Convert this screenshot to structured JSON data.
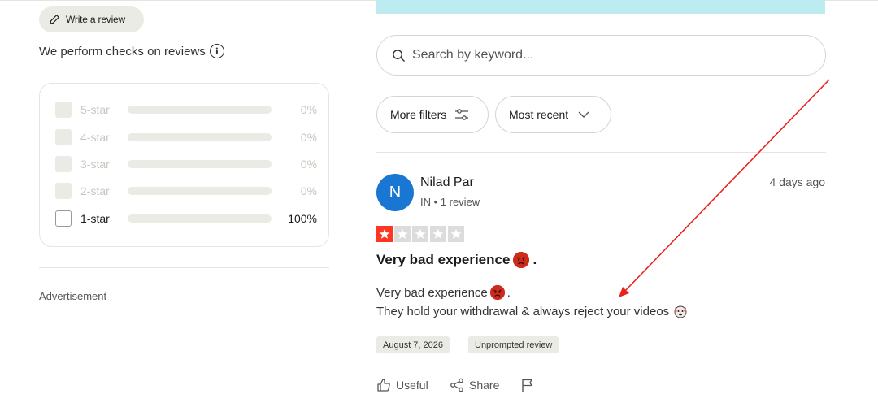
{
  "sidebar": {
    "write_review_label": "Write a review",
    "checks_text": "We perform checks on reviews",
    "info_glyph": "i",
    "ratings": [
      {
        "label": "5-star",
        "percent_text": "0%",
        "fraction": 0,
        "active": false
      },
      {
        "label": "4-star",
        "percent_text": "0%",
        "fraction": 0,
        "active": false
      },
      {
        "label": "3-star",
        "percent_text": "0%",
        "fraction": 0,
        "active": false
      },
      {
        "label": "2-star",
        "percent_text": "0%",
        "fraction": 0,
        "active": false
      },
      {
        "label": "1-star",
        "percent_text": "100%",
        "fraction": 1,
        "active": true
      }
    ],
    "advertisement_label": "Advertisement"
  },
  "search": {
    "placeholder": "Search by keyword..."
  },
  "filters": {
    "more_filters_label": "More filters",
    "sort_label": "Most recent"
  },
  "review": {
    "avatar_initial": "N",
    "reviewer_name": "Nilad Par",
    "reviewer_meta": "IN • 1 review",
    "posted_ago": "4 days ago",
    "rating": 1,
    "max_rating": 5,
    "title": "Very bad experience",
    "title_suffix": ".",
    "body_line1": "Very bad experience",
    "body_line1_suffix": ".",
    "body_line2": "They hold your withdrawal & always reject your videos",
    "date_tag": "August 7, 2026",
    "unprompted_tag": "Unprompted review",
    "useful_label": "Useful",
    "share_label": "Share"
  },
  "colors": {
    "star_active": "#ff3722",
    "avatar_bg": "#1976d2",
    "annotation_arrow": "#e8231e",
    "banner": "#bcebf0"
  },
  "icons": {
    "write": "pencil-icon",
    "info": "info-icon",
    "search": "search-icon",
    "filters": "sliders-icon",
    "sort": "chevron-down-icon",
    "useful": "thumbs-up-icon",
    "share": "share-icon",
    "flag": "flag-icon",
    "angry_face": "angry-face-icon",
    "dog_face": "dog-face-icon"
  }
}
